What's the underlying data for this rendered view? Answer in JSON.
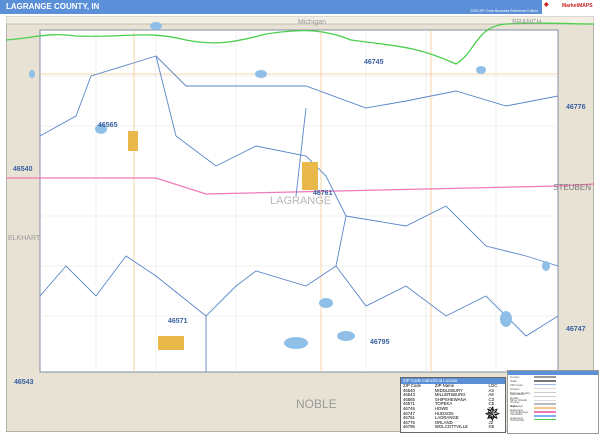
{
  "header": {
    "title": "LAGRANGE COUNTY, IN",
    "subtitle": "2020 ZIP Code Business Reference Edition",
    "logo_text": "MarketMAPS"
  },
  "colors": {
    "header": "#5b8fd8",
    "outside": "#e8e2d4",
    "zip_boundary": "#5a85c8",
    "interstate": "#4ccf4c",
    "us_highway": "#f07ab8",
    "water": "#8fbfe6",
    "city": "#e8b84a"
  },
  "map": {
    "regions": [
      {
        "name": "Michigan",
        "kind": "state"
      },
      {
        "name": "BRANCH",
        "kind": "county"
      },
      {
        "name": "STEUBEN",
        "kind": "county"
      },
      {
        "name": "ELKHART",
        "kind": "county"
      },
      {
        "name": "NOBLE",
        "kind": "county"
      },
      {
        "name": "LAGRANGE",
        "kind": "county"
      }
    ],
    "zips": [
      "46745",
      "46776",
      "46565",
      "46540",
      "46761",
      "46571",
      "46795",
      "46747",
      "46543"
    ]
  },
  "index": {
    "title": "ZIP Code Index/Grid Locator",
    "headers": [
      "ZIP Code",
      "ZIP Name",
      "LOC"
    ],
    "rows": [
      [
        "46540",
        "MIDDLEBURY",
        "A3"
      ],
      [
        "46543",
        "MILLERSBURG",
        "A6"
      ],
      [
        "46565",
        "SHIPSHEWANA",
        "C3"
      ],
      [
        "46571",
        "TOPEKA",
        "C5"
      ],
      [
        "46746",
        "HOWE",
        "D2"
      ],
      [
        "46747",
        "HUDSON",
        "J5"
      ],
      [
        "46761",
        "LAGRANGE",
        "G4"
      ],
      [
        "46776",
        "ORLAND",
        "J2"
      ],
      [
        "46795",
        "WOLCOTTVILLE",
        "G5"
      ]
    ]
  },
  "legend": {
    "items": [
      {
        "label": "County",
        "color": "#999999"
      },
      {
        "label": "State",
        "color": "#777777"
      },
      {
        "label": "ZIP Code",
        "color": "#9ab8e0"
      },
      {
        "label": "Streets",
        "color": "#dddddd"
      },
      {
        "label": "Primary Roads",
        "color": "#cccccc"
      },
      {
        "label": "Secondary Roads",
        "color": "#cccccc"
      },
      {
        "label": "Minor Roads",
        "color": "#dddddd"
      },
      {
        "label": "County Highways",
        "color": "#bbbbbb"
      },
      {
        "label": "State Highways",
        "color": "#f5c890"
      },
      {
        "label": "US Highways",
        "color": "#f07ab8"
      },
      {
        "label": "Interstate Highways",
        "color": "#7fb0f0"
      },
      {
        "label": "Toll Roads",
        "color": "#4ccf4c"
      }
    ]
  }
}
